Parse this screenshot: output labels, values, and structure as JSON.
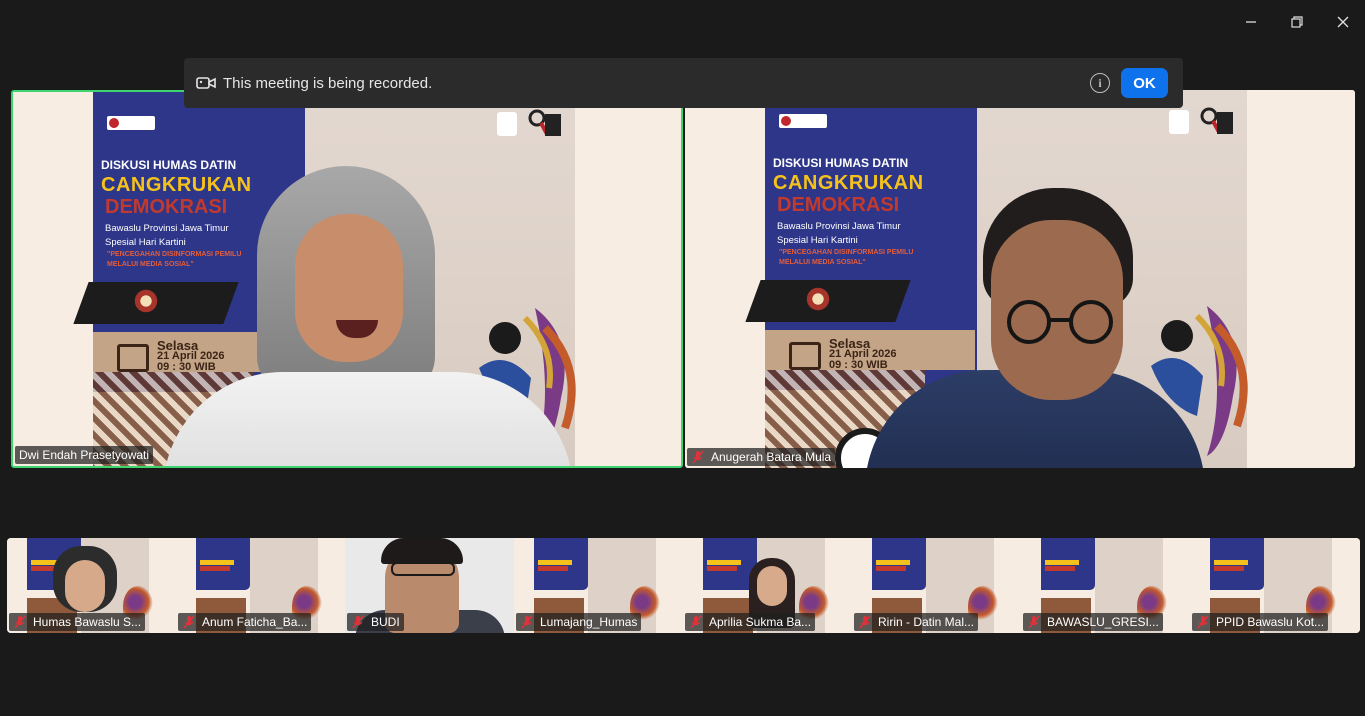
{
  "banner": {
    "message": "This meeting is being recorded.",
    "info_icon": "i",
    "ok_label": "OK"
  },
  "window_controls": [
    "minimize",
    "restore",
    "close"
  ],
  "poster": {
    "line1": "DISKUSI HUMAS DATIN",
    "line2": "CANGKRUKAN",
    "line3": "DEMOKRASI",
    "line4": "Bawaslu Provinsi Jawa Timur",
    "line5": "Spesial Hari Kartini",
    "line6": "\"PENCEGAHAN DISINFORMASI PEMILU",
    "line7": "MELALUI MEDIA SOSIAL\"",
    "day": "Selasa",
    "date": "21 April 2026",
    "time": "09 : 30 WIB"
  },
  "main_tiles": [
    {
      "name": "Dwi Endah Prasetyowati",
      "muted": false,
      "active_speaker": true
    },
    {
      "name": "Anugerah Batara Mula",
      "muted": true,
      "active_speaker": false
    }
  ],
  "thumbnails": [
    {
      "name": "Humas Bawaslu S...",
      "muted": true
    },
    {
      "name": "Anum Faticha_Ba...",
      "muted": true
    },
    {
      "name": "BUDI",
      "muted": true
    },
    {
      "name": "Lumajang_Humas",
      "muted": true
    },
    {
      "name": "Aprilia Sukma Ba...",
      "muted": true
    },
    {
      "name": "Ririn - Datin Mal...",
      "muted": true
    },
    {
      "name": "BAWASLU_GRESI...",
      "muted": true
    },
    {
      "name": "PPID Bawaslu Kot...",
      "muted": true
    }
  ],
  "colors": {
    "active_border": "#3dd56d",
    "ok_button": "#0e72ed",
    "mute_icon": "#e0323a",
    "background": "#1a1a1a"
  }
}
